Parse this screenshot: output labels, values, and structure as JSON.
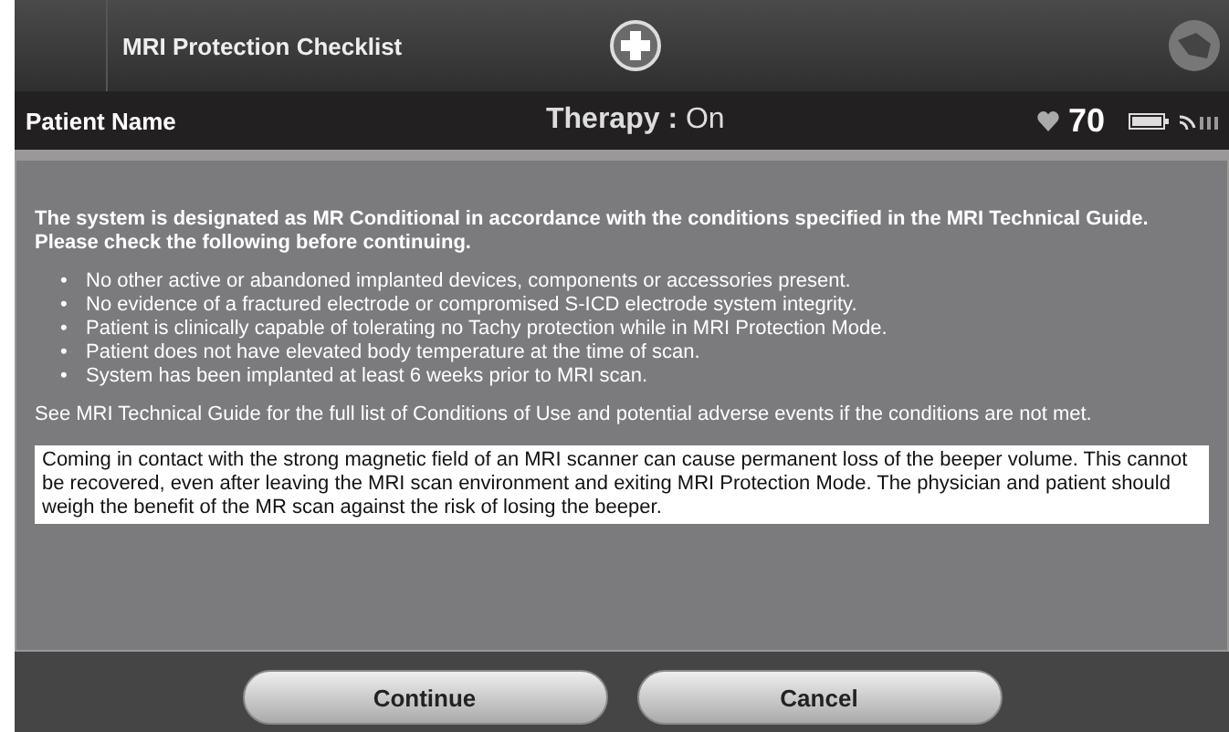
{
  "header": {
    "title": "MRI Protection Checklist"
  },
  "status_bar": {
    "patient": "Patient Name",
    "therapy": "**Therapy :** On",
    "heart_rate": "70"
  },
  "intro": "The system is designated as MR Conditional in accordance with the conditions specified in the MRI Technical Guide. Please check the following before continuing.",
  "conditions": [
    {
      "marker": "•",
      "text": "No other active or abandoned implanted devices, components or accessories present."
    },
    {
      "marker": "•",
      "text": "No evidence of a fractured electrode or compromised S-ICD electrode system integrity."
    },
    {
      "marker": "•",
      "text": "Patient is clinically capable of tolerating no Tachy protection while in MRI Protection Mode."
    },
    {
      "marker": "•",
      "text": "Patient does not have elevated body temperature at the time of scan."
    },
    {
      "marker": "•",
      "text": "System has been implanted at least 6 weeks prior to MRI scan."
    }
  ],
  "note": "See MRI Technical Guide for the full list of Conditions of Use and potential adverse events if the conditions are not met.",
  "warning": "Coming in contact with the strong magnetic field of an MRI scanner can cause permanent loss of the beeper volume. This cannot be recovered, even after leaving the MRI scan environment and exiting MRI Protection Mode. The physician and patient should weigh the benefit of the MR scan against the risk of losing the beeper.",
  "buttons": [
    "Continue",
    "Cancel"
  ]
}
